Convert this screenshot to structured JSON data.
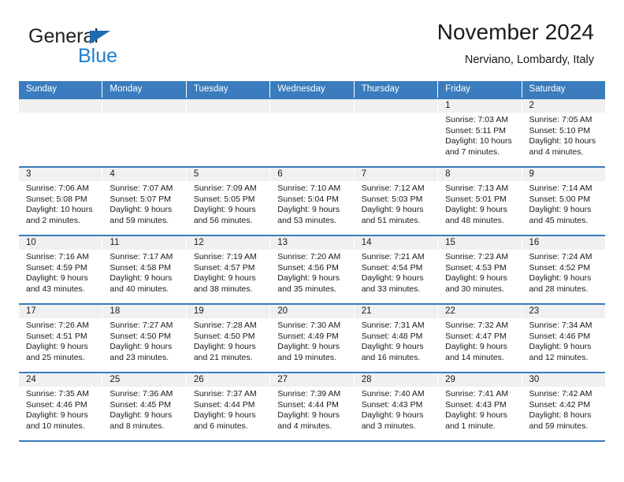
{
  "brand": {
    "name_top": "General",
    "name_bottom": "Blue",
    "accent_color": "#1f7fd0",
    "triangle_color": "#1f6cb4"
  },
  "header": {
    "title": "November 2024",
    "subtitle": "Nerviano, Lombardy, Italy"
  },
  "theme": {
    "header_band": "#3a7cbe",
    "day_number_band": "#f0f0f0",
    "text": "#1a1a1a"
  },
  "weekdays": [
    "Sunday",
    "Monday",
    "Tuesday",
    "Wednesday",
    "Thursday",
    "Friday",
    "Saturday"
  ],
  "weeks": [
    [
      {
        "day": "",
        "sunrise": "",
        "sunset": "",
        "daylight_line1": "",
        "daylight_line2": ""
      },
      {
        "day": "",
        "sunrise": "",
        "sunset": "",
        "daylight_line1": "",
        "daylight_line2": ""
      },
      {
        "day": "",
        "sunrise": "",
        "sunset": "",
        "daylight_line1": "",
        "daylight_line2": ""
      },
      {
        "day": "",
        "sunrise": "",
        "sunset": "",
        "daylight_line1": "",
        "daylight_line2": ""
      },
      {
        "day": "",
        "sunrise": "",
        "sunset": "",
        "daylight_line1": "",
        "daylight_line2": ""
      },
      {
        "day": "1",
        "sunrise": "Sunrise: 7:03 AM",
        "sunset": "Sunset: 5:11 PM",
        "daylight_line1": "Daylight: 10 hours",
        "daylight_line2": "and 7 minutes."
      },
      {
        "day": "2",
        "sunrise": "Sunrise: 7:05 AM",
        "sunset": "Sunset: 5:10 PM",
        "daylight_line1": "Daylight: 10 hours",
        "daylight_line2": "and 4 minutes."
      }
    ],
    [
      {
        "day": "3",
        "sunrise": "Sunrise: 7:06 AM",
        "sunset": "Sunset: 5:08 PM",
        "daylight_line1": "Daylight: 10 hours",
        "daylight_line2": "and 2 minutes."
      },
      {
        "day": "4",
        "sunrise": "Sunrise: 7:07 AM",
        "sunset": "Sunset: 5:07 PM",
        "daylight_line1": "Daylight: 9 hours",
        "daylight_line2": "and 59 minutes."
      },
      {
        "day": "5",
        "sunrise": "Sunrise: 7:09 AM",
        "sunset": "Sunset: 5:05 PM",
        "daylight_line1": "Daylight: 9 hours",
        "daylight_line2": "and 56 minutes."
      },
      {
        "day": "6",
        "sunrise": "Sunrise: 7:10 AM",
        "sunset": "Sunset: 5:04 PM",
        "daylight_line1": "Daylight: 9 hours",
        "daylight_line2": "and 53 minutes."
      },
      {
        "day": "7",
        "sunrise": "Sunrise: 7:12 AM",
        "sunset": "Sunset: 5:03 PM",
        "daylight_line1": "Daylight: 9 hours",
        "daylight_line2": "and 51 minutes."
      },
      {
        "day": "8",
        "sunrise": "Sunrise: 7:13 AM",
        "sunset": "Sunset: 5:01 PM",
        "daylight_line1": "Daylight: 9 hours",
        "daylight_line2": "and 48 minutes."
      },
      {
        "day": "9",
        "sunrise": "Sunrise: 7:14 AM",
        "sunset": "Sunset: 5:00 PM",
        "daylight_line1": "Daylight: 9 hours",
        "daylight_line2": "and 45 minutes."
      }
    ],
    [
      {
        "day": "10",
        "sunrise": "Sunrise: 7:16 AM",
        "sunset": "Sunset: 4:59 PM",
        "daylight_line1": "Daylight: 9 hours",
        "daylight_line2": "and 43 minutes."
      },
      {
        "day": "11",
        "sunrise": "Sunrise: 7:17 AM",
        "sunset": "Sunset: 4:58 PM",
        "daylight_line1": "Daylight: 9 hours",
        "daylight_line2": "and 40 minutes."
      },
      {
        "day": "12",
        "sunrise": "Sunrise: 7:19 AM",
        "sunset": "Sunset: 4:57 PM",
        "daylight_line1": "Daylight: 9 hours",
        "daylight_line2": "and 38 minutes."
      },
      {
        "day": "13",
        "sunrise": "Sunrise: 7:20 AM",
        "sunset": "Sunset: 4:56 PM",
        "daylight_line1": "Daylight: 9 hours",
        "daylight_line2": "and 35 minutes."
      },
      {
        "day": "14",
        "sunrise": "Sunrise: 7:21 AM",
        "sunset": "Sunset: 4:54 PM",
        "daylight_line1": "Daylight: 9 hours",
        "daylight_line2": "and 33 minutes."
      },
      {
        "day": "15",
        "sunrise": "Sunrise: 7:23 AM",
        "sunset": "Sunset: 4:53 PM",
        "daylight_line1": "Daylight: 9 hours",
        "daylight_line2": "and 30 minutes."
      },
      {
        "day": "16",
        "sunrise": "Sunrise: 7:24 AM",
        "sunset": "Sunset: 4:52 PM",
        "daylight_line1": "Daylight: 9 hours",
        "daylight_line2": "and 28 minutes."
      }
    ],
    [
      {
        "day": "17",
        "sunrise": "Sunrise: 7:26 AM",
        "sunset": "Sunset: 4:51 PM",
        "daylight_line1": "Daylight: 9 hours",
        "daylight_line2": "and 25 minutes."
      },
      {
        "day": "18",
        "sunrise": "Sunrise: 7:27 AM",
        "sunset": "Sunset: 4:50 PM",
        "daylight_line1": "Daylight: 9 hours",
        "daylight_line2": "and 23 minutes."
      },
      {
        "day": "19",
        "sunrise": "Sunrise: 7:28 AM",
        "sunset": "Sunset: 4:50 PM",
        "daylight_line1": "Daylight: 9 hours",
        "daylight_line2": "and 21 minutes."
      },
      {
        "day": "20",
        "sunrise": "Sunrise: 7:30 AM",
        "sunset": "Sunset: 4:49 PM",
        "daylight_line1": "Daylight: 9 hours",
        "daylight_line2": "and 19 minutes."
      },
      {
        "day": "21",
        "sunrise": "Sunrise: 7:31 AM",
        "sunset": "Sunset: 4:48 PM",
        "daylight_line1": "Daylight: 9 hours",
        "daylight_line2": "and 16 minutes."
      },
      {
        "day": "22",
        "sunrise": "Sunrise: 7:32 AM",
        "sunset": "Sunset: 4:47 PM",
        "daylight_line1": "Daylight: 9 hours",
        "daylight_line2": "and 14 minutes."
      },
      {
        "day": "23",
        "sunrise": "Sunrise: 7:34 AM",
        "sunset": "Sunset: 4:46 PM",
        "daylight_line1": "Daylight: 9 hours",
        "daylight_line2": "and 12 minutes."
      }
    ],
    [
      {
        "day": "24",
        "sunrise": "Sunrise: 7:35 AM",
        "sunset": "Sunset: 4:46 PM",
        "daylight_line1": "Daylight: 9 hours",
        "daylight_line2": "and 10 minutes."
      },
      {
        "day": "25",
        "sunrise": "Sunrise: 7:36 AM",
        "sunset": "Sunset: 4:45 PM",
        "daylight_line1": "Daylight: 9 hours",
        "daylight_line2": "and 8 minutes."
      },
      {
        "day": "26",
        "sunrise": "Sunrise: 7:37 AM",
        "sunset": "Sunset: 4:44 PM",
        "daylight_line1": "Daylight: 9 hours",
        "daylight_line2": "and 6 minutes."
      },
      {
        "day": "27",
        "sunrise": "Sunrise: 7:39 AM",
        "sunset": "Sunset: 4:44 PM",
        "daylight_line1": "Daylight: 9 hours",
        "daylight_line2": "and 4 minutes."
      },
      {
        "day": "28",
        "sunrise": "Sunrise: 7:40 AM",
        "sunset": "Sunset: 4:43 PM",
        "daylight_line1": "Daylight: 9 hours",
        "daylight_line2": "and 3 minutes."
      },
      {
        "day": "29",
        "sunrise": "Sunrise: 7:41 AM",
        "sunset": "Sunset: 4:43 PM",
        "daylight_line1": "Daylight: 9 hours",
        "daylight_line2": "and 1 minute."
      },
      {
        "day": "30",
        "sunrise": "Sunrise: 7:42 AM",
        "sunset": "Sunset: 4:42 PM",
        "daylight_line1": "Daylight: 8 hours",
        "daylight_line2": "and 59 minutes."
      }
    ]
  ]
}
